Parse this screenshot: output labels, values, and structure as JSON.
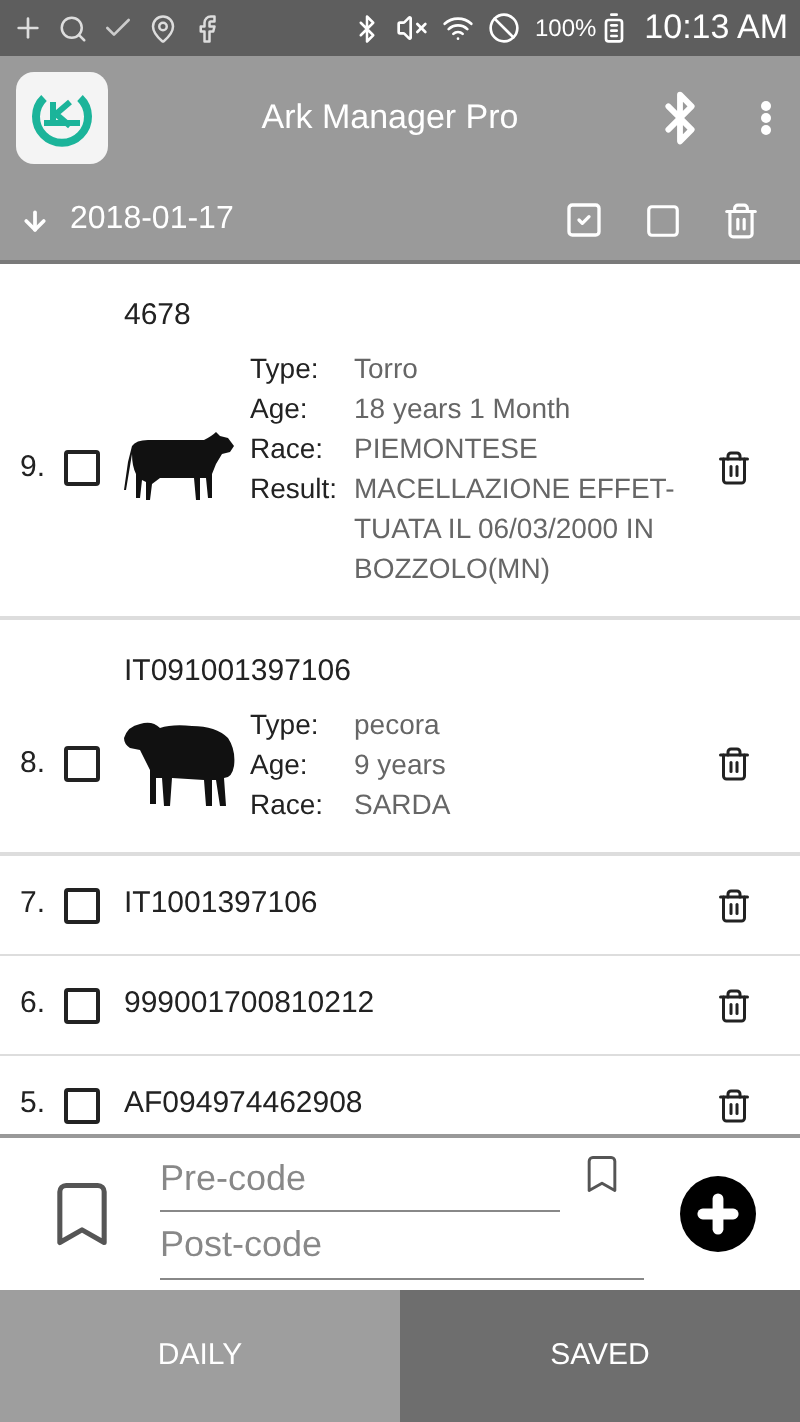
{
  "status_bar": {
    "battery": "100%",
    "time": "10:13 AM"
  },
  "app_bar": {
    "title": "Ark Manager Pro"
  },
  "date_bar": {
    "date": "2018-01-17"
  },
  "records": [
    {
      "number": "9.",
      "checked": false,
      "code": "4678",
      "kind": "cow",
      "details": [
        {
          "label": "Type:",
          "value": "Torro"
        },
        {
          "label": "Age:",
          "value": "18 years 1 Month"
        },
        {
          "label": "Race:",
          "value": "PIEMONTESE"
        },
        {
          "label": "Result:",
          "value": "MACELLAZIONE EFFET-TUATA IL 06/03/2000 IN BOZZOLO(MN)"
        }
      ]
    },
    {
      "number": "8.",
      "checked": false,
      "code": "IT091001397106",
      "kind": "sheep",
      "details": [
        {
          "label": "Type:",
          "value": "pecora"
        },
        {
          "label": "Age:",
          "value": "9 years"
        },
        {
          "label": "Race:",
          "value": "SARDA"
        }
      ]
    },
    {
      "number": "7.",
      "checked": false,
      "code": "IT1001397106",
      "kind": "plain"
    },
    {
      "number": "6.",
      "checked": false,
      "code": "999001700810212",
      "kind": "plain"
    },
    {
      "number": "5.",
      "checked": false,
      "code": "AF094974462908",
      "kind": "plain"
    }
  ],
  "entry": {
    "pre_code": {
      "placeholder": "Pre-code"
    },
    "post_code": {
      "placeholder": "Post-code"
    }
  },
  "tabs": [
    {
      "label": "DAILY",
      "selected": false
    },
    {
      "label": "SAVED",
      "selected": true
    }
  ]
}
